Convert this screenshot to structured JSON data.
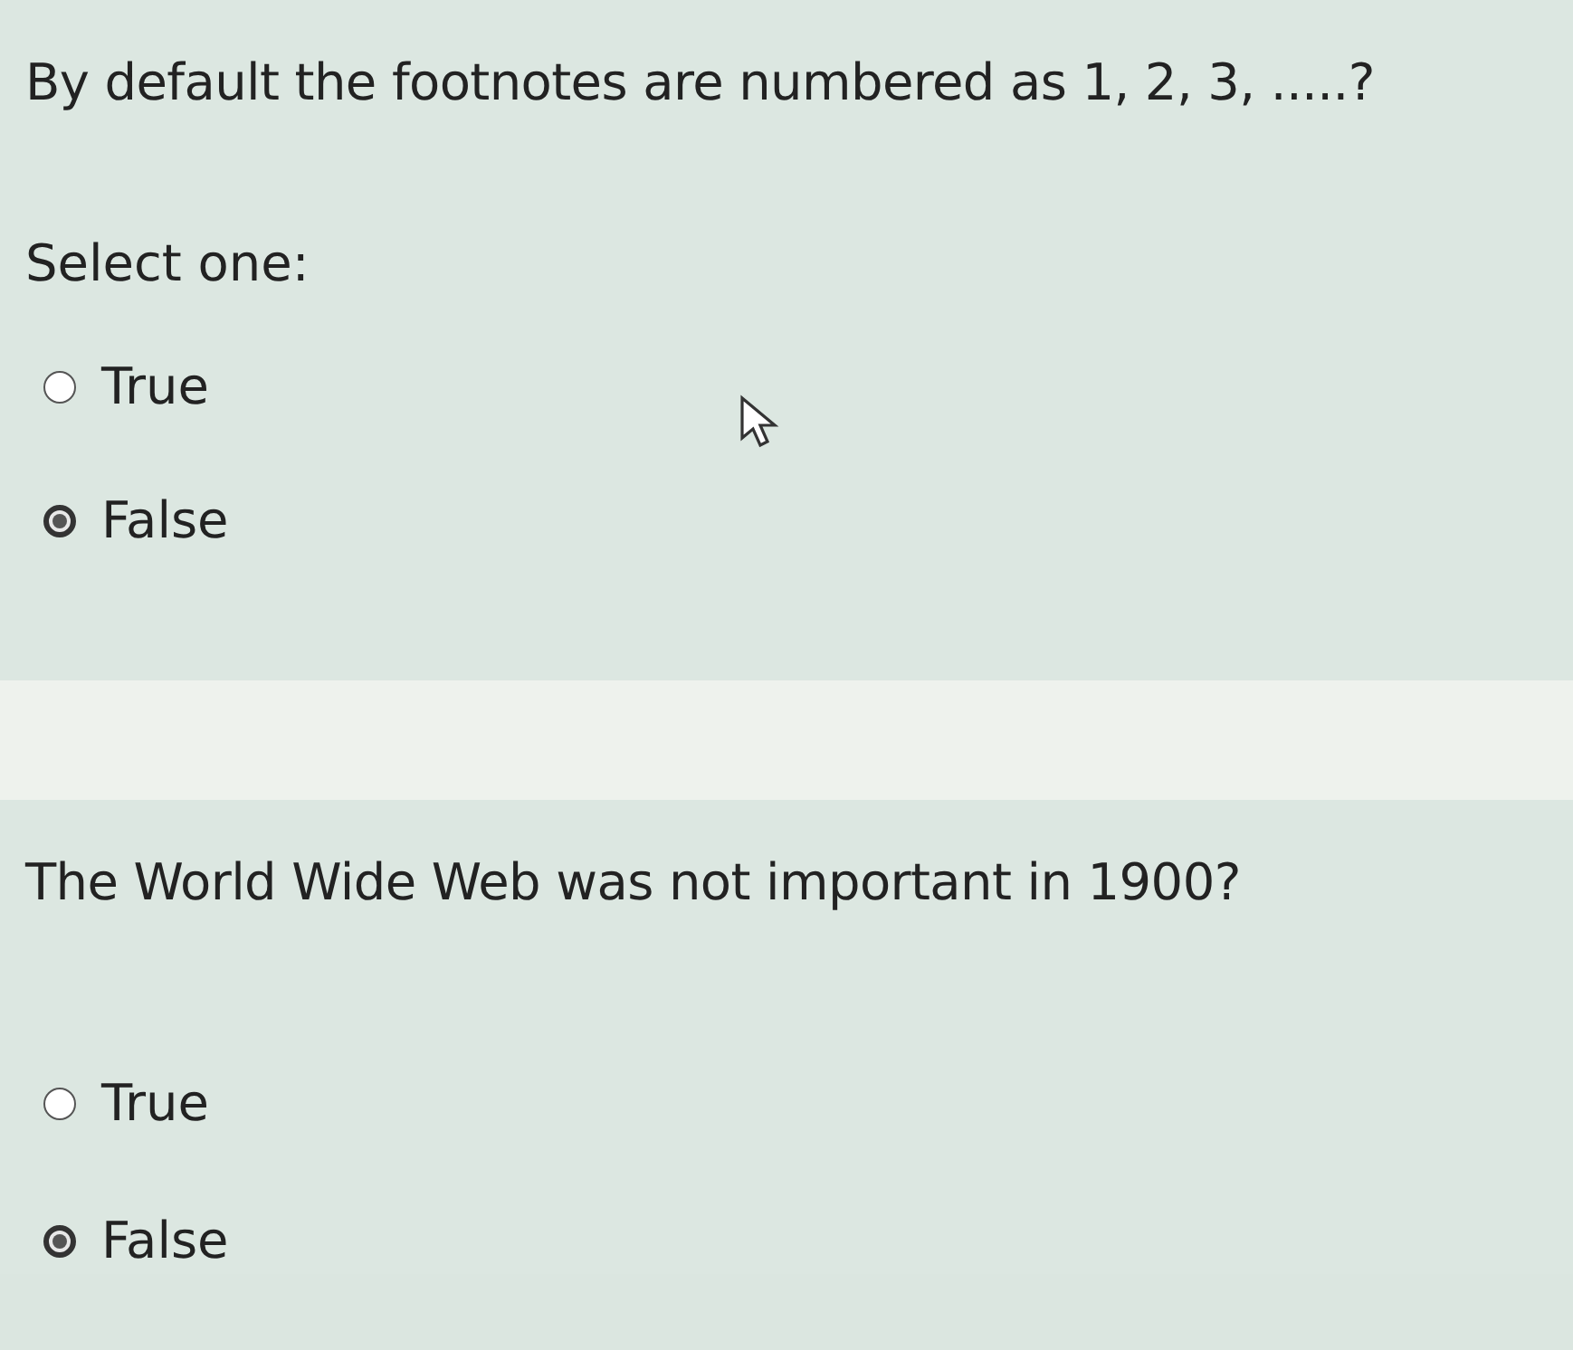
{
  "questions": [
    {
      "prompt": "By default the footnotes are numbered as 1, 2, 3, .....?",
      "instruction": "Select one:",
      "options": [
        {
          "label": "True",
          "selected": false
        },
        {
          "label": "False",
          "selected": true
        }
      ]
    },
    {
      "prompt": "The World Wide Web was not important in 1900?",
      "options": [
        {
          "label": "True",
          "selected": false
        },
        {
          "label": "False",
          "selected": true
        }
      ]
    }
  ]
}
